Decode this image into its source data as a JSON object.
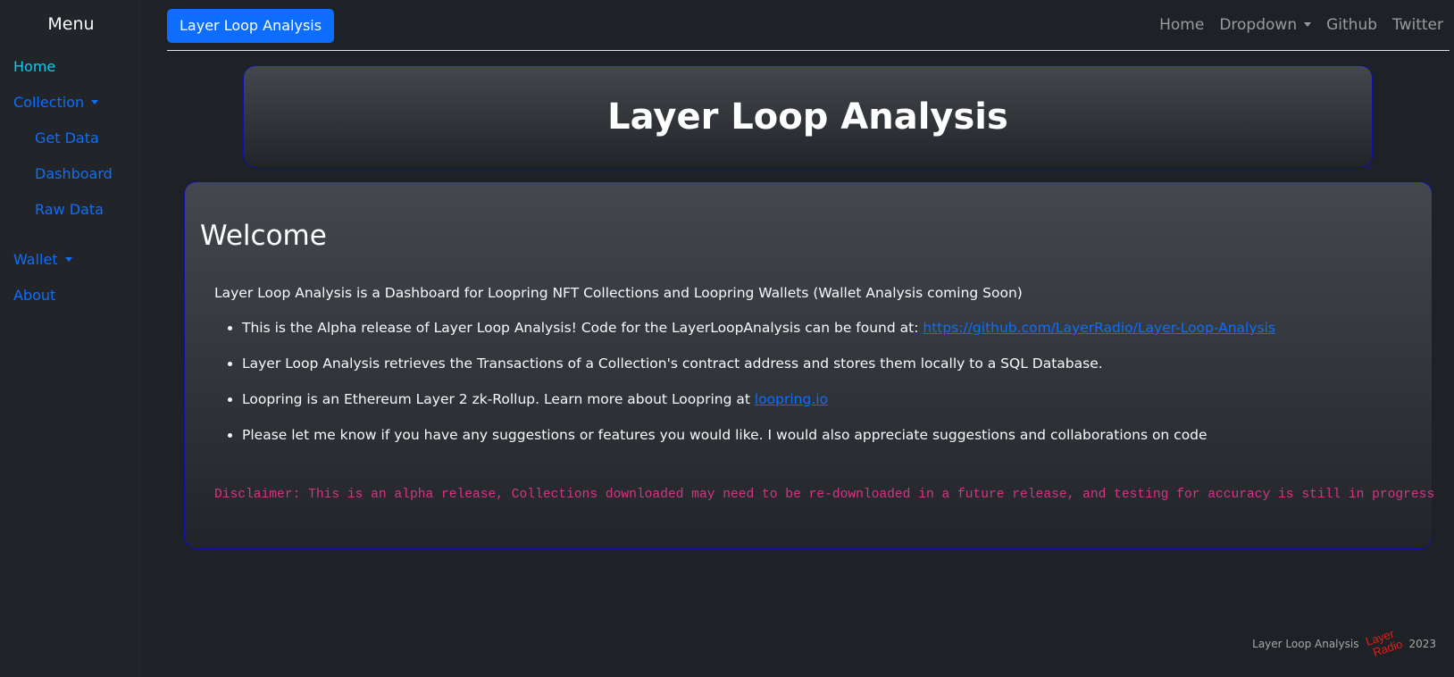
{
  "sidebar": {
    "title": "Menu",
    "items": {
      "home": "Home",
      "collection": "Collection",
      "get_data": "Get Data",
      "dashboard": "Dashboard",
      "raw_data": "Raw Data",
      "wallet": "Wallet",
      "about": "About"
    }
  },
  "topbar": {
    "brand": "Layer Loop Analysis",
    "nav": {
      "home": "Home",
      "dropdown": "Dropdown",
      "github": "Github",
      "twitter": "Twitter"
    }
  },
  "header": {
    "title": "Layer Loop Analysis"
  },
  "welcome": {
    "title": "Welcome",
    "intro": "Layer Loop Analysis is a Dashboard for Loopring NFT Collections and Loopring Wallets (Wallet Analysis coming Soon)",
    "bullets": [
      {
        "text": "This is the Alpha release of Layer Loop Analysis! Code for the LayerLoopAnalysis can be found at: ",
        "link": "https://github.com/LayerRadio/Layer-Loop-Analysis"
      },
      {
        "text": "Layer Loop Analysis retrieves the Transactions of a Collection's contract address and stores them locally to a SQL Database."
      },
      {
        "text": "Loopring is an Ethereum Layer 2 zk-Rollup. Learn more about Loopring at ",
        "link": "loopring.io"
      },
      {
        "text": "Please let me know if you have any suggestions or features you would like. I would also appreciate suggestions and collaborations on code"
      }
    ],
    "disclaimer": "Disclaimer: This is an alpha release, Collections downloaded may need to be re-downloaded in a future release, and testing for accuracy is still in progress"
  },
  "footer": {
    "text": "Layer Loop Analysis",
    "logo_top": "Layer",
    "logo_bottom": "Radio",
    "year": "2023"
  },
  "colors": {
    "accent": "#0d6efd",
    "active_link": "#0dcaf0",
    "disclaimer": "#d63384",
    "card_border": "#0b0fb0",
    "logo": "#e0201c"
  }
}
